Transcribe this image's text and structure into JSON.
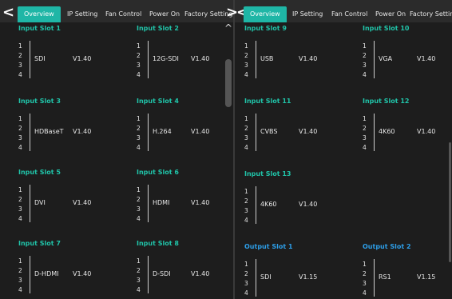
{
  "left": {
    "tabs": [
      "Overview",
      "IP Setting",
      "Fan Control",
      "Power On",
      "Factory Setting"
    ],
    "active_tab": "Overview",
    "arrow_left": "<",
    "scroll_up": "^",
    "slots": [
      {
        "title": "Input Slot 1",
        "nums": [
          "1",
          "2",
          "3",
          "4"
        ],
        "type": "SDI",
        "version": "V1.40"
      },
      {
        "title": "Input Slot 2",
        "nums": [
          "1",
          "2",
          "3",
          "4"
        ],
        "type": "12G-SDI",
        "version": "V1.40"
      },
      {
        "title": "Input Slot 3",
        "nums": [
          "1",
          "2",
          "3",
          "4"
        ],
        "type": "HDBaseT",
        "version": "V1.40"
      },
      {
        "title": "Input Slot 4",
        "nums": [
          "1",
          "2",
          "3",
          "4"
        ],
        "type": "H.264",
        "version": "V1.40"
      },
      {
        "title": "Input Slot 5",
        "nums": [
          "1",
          "2",
          "3",
          "4"
        ],
        "type": "DVI",
        "version": "V1.40"
      },
      {
        "title": "Input Slot 6",
        "nums": [
          "1",
          "2",
          "3",
          "4"
        ],
        "type": "HDMI",
        "version": "V1.40"
      },
      {
        "title": "Input Slot 7",
        "nums": [
          "1",
          "2",
          "3",
          "4"
        ],
        "type": "D-HDMI",
        "version": "V1.40"
      },
      {
        "title": "Input Slot 8",
        "nums": [
          "1",
          "2",
          "3",
          "4"
        ],
        "type": "D-SDI",
        "version": "V1.40"
      }
    ]
  },
  "right": {
    "tabs": [
      "Overview",
      "IP Setting",
      "Fan Control",
      "Power On",
      "Factory Setting"
    ],
    "active_tab": "Overview",
    "arrow_left": "<",
    "slots": [
      {
        "title": "Input Slot 9",
        "nums": [
          "1",
          "2",
          "3",
          "4"
        ],
        "type": "USB",
        "version": "V1.40"
      },
      {
        "title": "Input Slot 10",
        "nums": [
          "1",
          "2",
          "3",
          "4"
        ],
        "type": "VGA",
        "version": "V1.40"
      },
      {
        "title": "Input Slot 11",
        "nums": [
          "1",
          "2",
          "3",
          "4"
        ],
        "type": "CVBS",
        "version": "V1.40"
      },
      {
        "title": "Input Slot 12",
        "nums": [
          "1",
          "2",
          "3",
          "4"
        ],
        "type": "4K60",
        "version": "V1.40"
      },
      {
        "title": "Input Slot 13",
        "nums": [
          "1",
          "2",
          "3",
          "4"
        ],
        "type": "4K60",
        "version": "V1.40"
      },
      {
        "title": "Output Slot 1",
        "nums": [
          "1",
          "2",
          "3",
          "4"
        ],
        "type": "SDI",
        "version": "V1.15"
      },
      {
        "title": "Output Slot 2",
        "nums": [
          "1",
          "2",
          "3",
          "4"
        ],
        "type": "RS1",
        "version": "V1.15"
      }
    ]
  },
  "divider_arrow": ">",
  "colors": {
    "input_title": "#20c4a9",
    "output_title": "#2d9ee8",
    "active_tab": "#1fb6a6",
    "background": "#1d1d1d"
  }
}
